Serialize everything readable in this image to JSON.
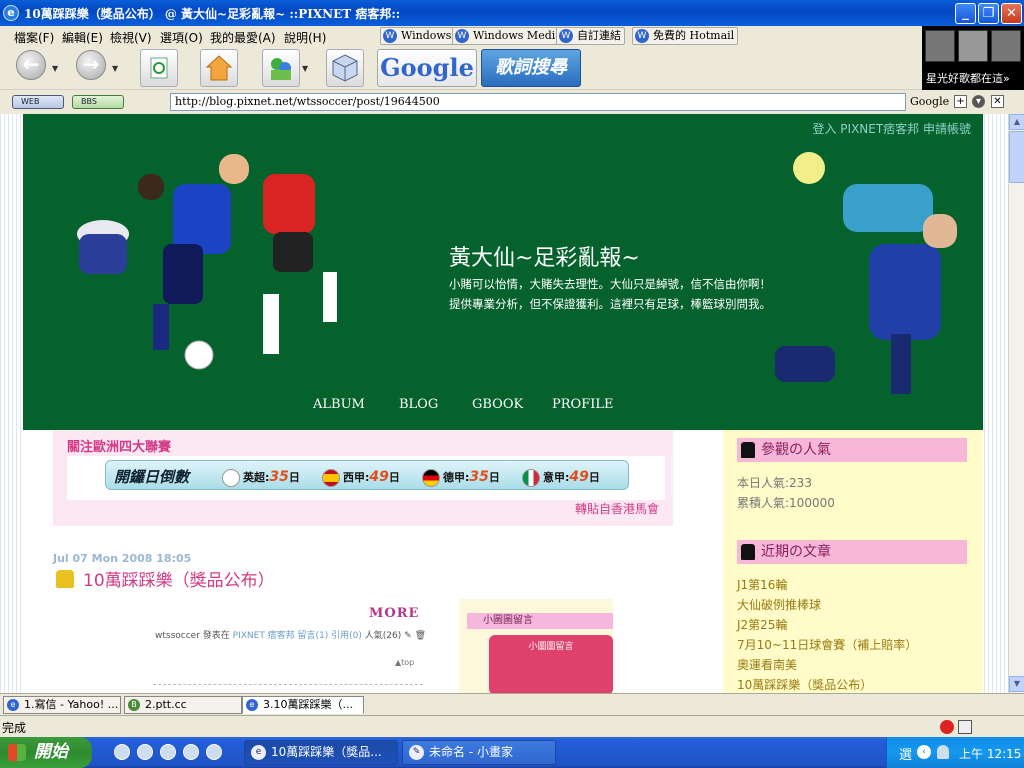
{
  "window": {
    "title": "10萬踩踩樂（獎品公布） @ 黃大仙~足彩亂報~ ::PIXNET 痞客邦::",
    "minimize": "_",
    "maximize": "❐",
    "close": "✕"
  },
  "brand_box": {
    "caption": "星光好歌都在這»"
  },
  "menu": {
    "items": [
      "檔案(F)",
      "編輯(E)",
      "檢視(V)",
      "選項(O)",
      "我的最愛(A)",
      "說明(H)"
    ],
    "links": [
      "Windows",
      "Windows Media",
      "自訂連結",
      "免費的 Hotmail"
    ]
  },
  "toolbar": {
    "google": "Google",
    "lyrics": "歌詞搜尋",
    "back_glyph": "←",
    "forward_glyph": "→"
  },
  "address": {
    "web_pill": "WEB",
    "bbs_pill": "BBS",
    "url": "http://blog.pixnet.net/wtssoccer/post/19644500",
    "search_label": "Google"
  },
  "header": {
    "login_links": "登入 PIXNET痞客邦 申請帳號",
    "title": "黃大仙~足彩亂報~",
    "desc_line1": "小賭可以怡情，大賭失去理性。大仙只是綽號，信不信由你啊！",
    "desc_line2": "提供專業分析，但不保證獲利。這裡只有足球，棒籃球別問我。",
    "nav": [
      "ALBUM",
      "BLOG",
      "GBOOK",
      "PROFILE"
    ]
  },
  "countdown": {
    "heading": "關注歐洲四大聯賽",
    "title": "開鑼日倒數",
    "leagues": [
      {
        "name": "英超:",
        "days": "35",
        "unit": "日",
        "flag_color": "#cf1a2b"
      },
      {
        "name": "西甲:",
        "days": "49",
        "unit": "日",
        "flag_color": "#f2b800"
      },
      {
        "name": "德甲:",
        "days": "35",
        "unit": "日",
        "flag_color": "#d42a1a"
      },
      {
        "name": "意甲:",
        "days": "49",
        "unit": "日",
        "flag_color": "#2a9a3a"
      }
    ],
    "credit": "轉貼自香港馬會"
  },
  "post": {
    "date": "Jul 07 Mon 2008 18:05",
    "title": "10萬踩踩樂（獎品公布）",
    "more": "MORE",
    "meta_prefix": "wtssoccer 發表在",
    "meta_links": "PIXNET 痞客邦 留言(1) 引用(0)",
    "meta_suffix": "人氣(26)",
    "top": "▲top"
  },
  "widget": {
    "heading": "小圖圖留言",
    "image_caption": "小圖圖留言"
  },
  "sidebar": {
    "popularity_heading": "參觀の人氣",
    "today": "本日人氣:233",
    "total": "累積人氣:100000",
    "recent_heading": "近期の文章",
    "recent_posts": [
      "J1第16輪",
      "大仙破例推棒球",
      "J2第25輪",
      "7月10~11日球會賽（補上賠率）",
      "奧運看南美",
      "10萬踩踩樂（獎品公布）"
    ]
  },
  "tabs": [
    {
      "label": "1.寫信 - Yahoo! ..."
    },
    {
      "label": "2.ptt.cc"
    },
    {
      "label": "3.10萬踩踩樂（..."
    }
  ],
  "status": {
    "text": "完成"
  },
  "taskbar": {
    "start": "開始",
    "tasks": [
      "10萬踩踩樂（獎品...",
      "未命名 - 小畫家"
    ],
    "ime": "選",
    "clock": "上午 12:15"
  }
}
